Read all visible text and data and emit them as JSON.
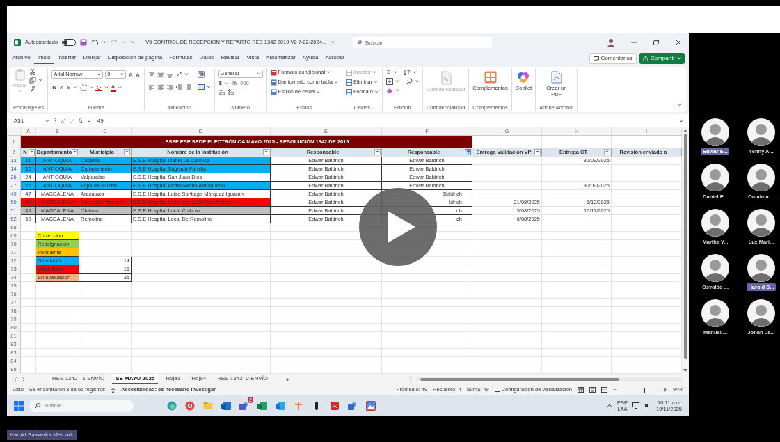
{
  "excel": {
    "autosave_label": "Autoguardado",
    "autosave_on": false,
    "title": "V5 CONTROL DE RECEPCION Y REPARTO RES 1342 2019 V2 7-02-2024...",
    "search_placeholder": "Buscar",
    "menu_tabs": [
      {
        "label": "Archivo",
        "selected": false
      },
      {
        "label": "Inicio",
        "selected": true
      },
      {
        "label": "Insertar",
        "selected": false
      },
      {
        "label": "Dibujar",
        "selected": false
      },
      {
        "label": "Disposición de página",
        "selected": false
      },
      {
        "label": "Fórmulas",
        "selected": false
      },
      {
        "label": "Datos",
        "selected": false
      },
      {
        "label": "Revisar",
        "selected": false
      },
      {
        "label": "Vista",
        "selected": false
      },
      {
        "label": "Automatizar",
        "selected": false
      },
      {
        "label": "Ayuda",
        "selected": false
      },
      {
        "label": "Acrobat",
        "selected": false
      }
    ],
    "comments_button": "Comentarios",
    "share_button": "Compartir",
    "ribbon": [
      {
        "kind": "clipboard",
        "label": "Portapapeles",
        "paste": "Pegar"
      },
      {
        "kind": "font",
        "label": "Fuente",
        "font": "Arial Narrow",
        "size": "9",
        "grow_font": "A",
        "shrink_font": "A",
        "bold": "N",
        "italic": "K",
        "underline": "S",
        "font_color": "A"
      },
      {
        "kind": "alignment",
        "label": "Alineación"
      },
      {
        "kind": "number",
        "label": "Número",
        "format": "General",
        "currency": "$",
        "percent": "%",
        "thousands": "000"
      },
      {
        "kind": "styles",
        "label": "Estilos",
        "items": [
          "Formato condicional",
          "Dar formato como tabla",
          "Estilos de celda"
        ]
      },
      {
        "kind": "cells",
        "label": "Celdas",
        "items": [
          {
            "text": "Insertar",
            "disabled": true
          },
          {
            "text": "Eliminar",
            "disabled": false
          },
          {
            "text": "Formato",
            "disabled": false
          }
        ]
      },
      {
        "kind": "editing",
        "label": "Edición",
        "autosum": "Σ"
      },
      {
        "kind": "sensitivity",
        "label": "Confidencialidad",
        "button": "Confidencialidad",
        "disabled": true
      },
      {
        "kind": "addins",
        "label": "Complementos",
        "button": "Complementos",
        "disabled": false
      },
      {
        "kind": "copilot",
        "button": "Copilot",
        "disabled": false
      },
      {
        "kind": "acrobat",
        "label": "Adobe Acrobat",
        "button": "Crear un PDF",
        "disabled": false
      }
    ],
    "name_box": "A51",
    "function_label": "fx",
    "formula_value": "49",
    "column_letters": [
      "A",
      "B",
      "C",
      "D",
      "E",
      "F",
      "G",
      "H",
      "I"
    ],
    "banner": {
      "row": "1",
      "text": "PSFF ESE SEDE ELECTRÓNICA MAYO 2025 - RESOLUCIÓN 1342 DE 2019"
    },
    "header": {
      "row": "2",
      "cells": [
        {
          "text": "N",
          "filter": true,
          "filtered": false
        },
        {
          "text": "Departamento",
          "filter": true,
          "filtered": false
        },
        {
          "text": "Municipio",
          "filter": true,
          "filtered": false
        },
        {
          "text": "Nombre de la institución",
          "filter": true,
          "filtered": false
        },
        {
          "text": "Responsable",
          "filter": true,
          "filtered": false
        },
        {
          "text": "Responsable",
          "filter": true,
          "filtered": true
        },
        {
          "text": "Entrega Validación VP",
          "filter": true,
          "filtered": false
        },
        {
          "text": "Entrega  CT",
          "filter": true,
          "filtered": false
        },
        {
          "text": "Revisión enviado a",
          "filter": false
        }
      ]
    },
    "rows": [
      {
        "kind": "data",
        "row": "13",
        "color": "#00b0f0",
        "n": "11",
        "department": "ANTIOQUIA",
        "municipality": "Caceres",
        "institution": "E.S.E Hospital Isabel La Católica",
        "responsible_1": "Edwar Baldrich",
        "responsible_2": "Edwar Baldrich",
        "ct_delivery": "30/09/2025"
      },
      {
        "kind": "data",
        "row": "14",
        "color": "#00b0f0",
        "n": "12",
        "department": "ANTIOQUIA",
        "municipality": "Campamento",
        "institution": "E.S.E Hospital Sagrada Familia",
        "responsible_1": "Edwar Baldrich",
        "responsible_2": "Edwar Baldrich"
      },
      {
        "kind": "data",
        "row": "26",
        "color": "#ffffff",
        "n": "24",
        "department": "ANTIOQUIA",
        "municipality": "Valparaiso",
        "institution": "E.S.E Hospital San Juan Dios",
        "responsible_1": "Edwar Baldrich",
        "responsible_2": "Edwar Baldrich"
      },
      {
        "kind": "data",
        "row": "27",
        "color": "#00b0f0",
        "n": "25",
        "department": "ANTIOQUIA",
        "municipality": "Vigia del Fuerte",
        "institution": "E.S.E Hospital Atrato Medio Antioqueño",
        "responsible_1": "Edwar Baldrich",
        "responsible_2": "Edwar Baldrich",
        "ct_delivery": "30/09/2025"
      },
      {
        "kind": "data",
        "row": "49",
        "color": "#ffffff",
        "n": "47",
        "department": "MAGDALENA",
        "municipality": "Aracataca",
        "institution": "E.S.E Hospital Luisa Santiaga Márquez Iguarán",
        "responsible_1": "Edwar Baldrich",
        "responsible_2": "Baldrich",
        "responsible_2_cut": true
      },
      {
        "kind": "data",
        "row": "50",
        "color": "#ff0000",
        "n": "48",
        "department": "MAGDALENA",
        "municipality": "Cerro San Antonio",
        "institution": "E.S.E Hospital Local Cerro De San Antonio",
        "responsible_1": "Edwar Baldrich",
        "responsible_2": "ldrich",
        "responsible_2_cut": true,
        "vp_delivery": "21/08/2025",
        "ct_delivery": "6/10/2025"
      },
      {
        "kind": "data",
        "row": "51",
        "color": "#bfbfbf",
        "n": "49",
        "department": "MAGDALENA",
        "municipality": "Chibolo",
        "institution": "E.S.E Hospital Local Chibolo",
        "responsible_1": "Edwar Baldrich",
        "responsible_2": "ich",
        "responsible_2_cut": true,
        "vp_delivery": "5/08/2025",
        "ct_delivery": "10/11/2025"
      },
      {
        "kind": "data",
        "row": "52",
        "color": "#ffffff",
        "n": "50",
        "department": "MAGDALENA",
        "municipality": "Remolino",
        "institution": "E.S.E Hospital Local De Remolino",
        "responsible_1": "Edwar Baldrich",
        "responsible_2": "ich",
        "responsible_2_cut": true,
        "vp_delivery": "6/08/2025"
      },
      {
        "kind": "empty",
        "row": "68"
      },
      {
        "kind": "legend",
        "row": "69",
        "label": "Corrección",
        "color": "#ffff00"
      },
      {
        "kind": "legend",
        "row": "70",
        "label": "Reasignación",
        "color": "#92d050"
      },
      {
        "kind": "legend",
        "row": "71",
        "label": "Pendiente",
        "color": "#ffc000"
      },
      {
        "kind": "legend",
        "row": "72",
        "label": "Devolución",
        "color": "#00b0f0",
        "count": "14"
      },
      {
        "kind": "legend",
        "row": "73",
        "label": "Inhabilitado",
        "color": "#ff0000",
        "count": "16"
      },
      {
        "kind": "legend",
        "row": "74",
        "label": "En evaluación",
        "color": "#f4b183",
        "count": "35"
      },
      {
        "kind": "empty",
        "row": "75"
      },
      {
        "kind": "empty",
        "row": "76"
      },
      {
        "kind": "empty",
        "row": "77"
      },
      {
        "kind": "empty",
        "row": "78"
      },
      {
        "kind": "empty",
        "row": "79"
      },
      {
        "kind": "empty",
        "row": "80"
      },
      {
        "kind": "empty",
        "row": "81"
      },
      {
        "kind": "empty",
        "row": "82"
      },
      {
        "kind": "empty",
        "row": "83"
      },
      {
        "kind": "empty",
        "row": "84"
      },
      {
        "kind": "empty",
        "row": "85"
      }
    ],
    "sheet_tabs": [
      {
        "label": "RES 1342 - 1 ENVÍO",
        "selected": false
      },
      {
        "label": "SE MAYO 2025",
        "selected": true
      },
      {
        "label": "Hoja1",
        "selected": false
      },
      {
        "label": "Hoja4",
        "selected": false
      },
      {
        "label": "RES 1342 -2 ENVÍO",
        "selected": false
      }
    ],
    "add_sheet": "+",
    "status": {
      "ready": "Listo",
      "records": "Se encontraron 8 de 65 registros",
      "accessibility": "Accesibilidad: es necesario investigar",
      "average": "Promedio: 49",
      "count": "Recuento: 4",
      "sum": "Suma: 49",
      "display_settings": "Configuración de visualización",
      "zoom": "94%",
      "level": 0.6
    }
  },
  "taskbar": {
    "search_placeholder": "Buscar",
    "badge": "2",
    "language": [
      "ESP",
      "LAA"
    ],
    "time": "10:11 a.m.",
    "date": "10/11/2025"
  },
  "participants": [
    {
      "name": "Edwar E...",
      "highlighted": true
    },
    {
      "name": "Yenny A...",
      "highlighted": false
    },
    {
      "name": "Daniel E...",
      "highlighted": false
    },
    {
      "name": "Omaima ...",
      "highlighted": false
    },
    {
      "name": "Martha Y...",
      "highlighted": false
    },
    {
      "name": "Luz Mari...",
      "highlighted": false
    },
    {
      "name": "Osvaldo ...",
      "highlighted": false
    },
    {
      "name": "Harold S...",
      "highlighted": true
    },
    {
      "name": "Manuel ...",
      "highlighted": false
    },
    {
      "name": "Johan Le...",
      "highlighted": false
    }
  ],
  "presenter_tag": "Harold Saavedra Mercado"
}
